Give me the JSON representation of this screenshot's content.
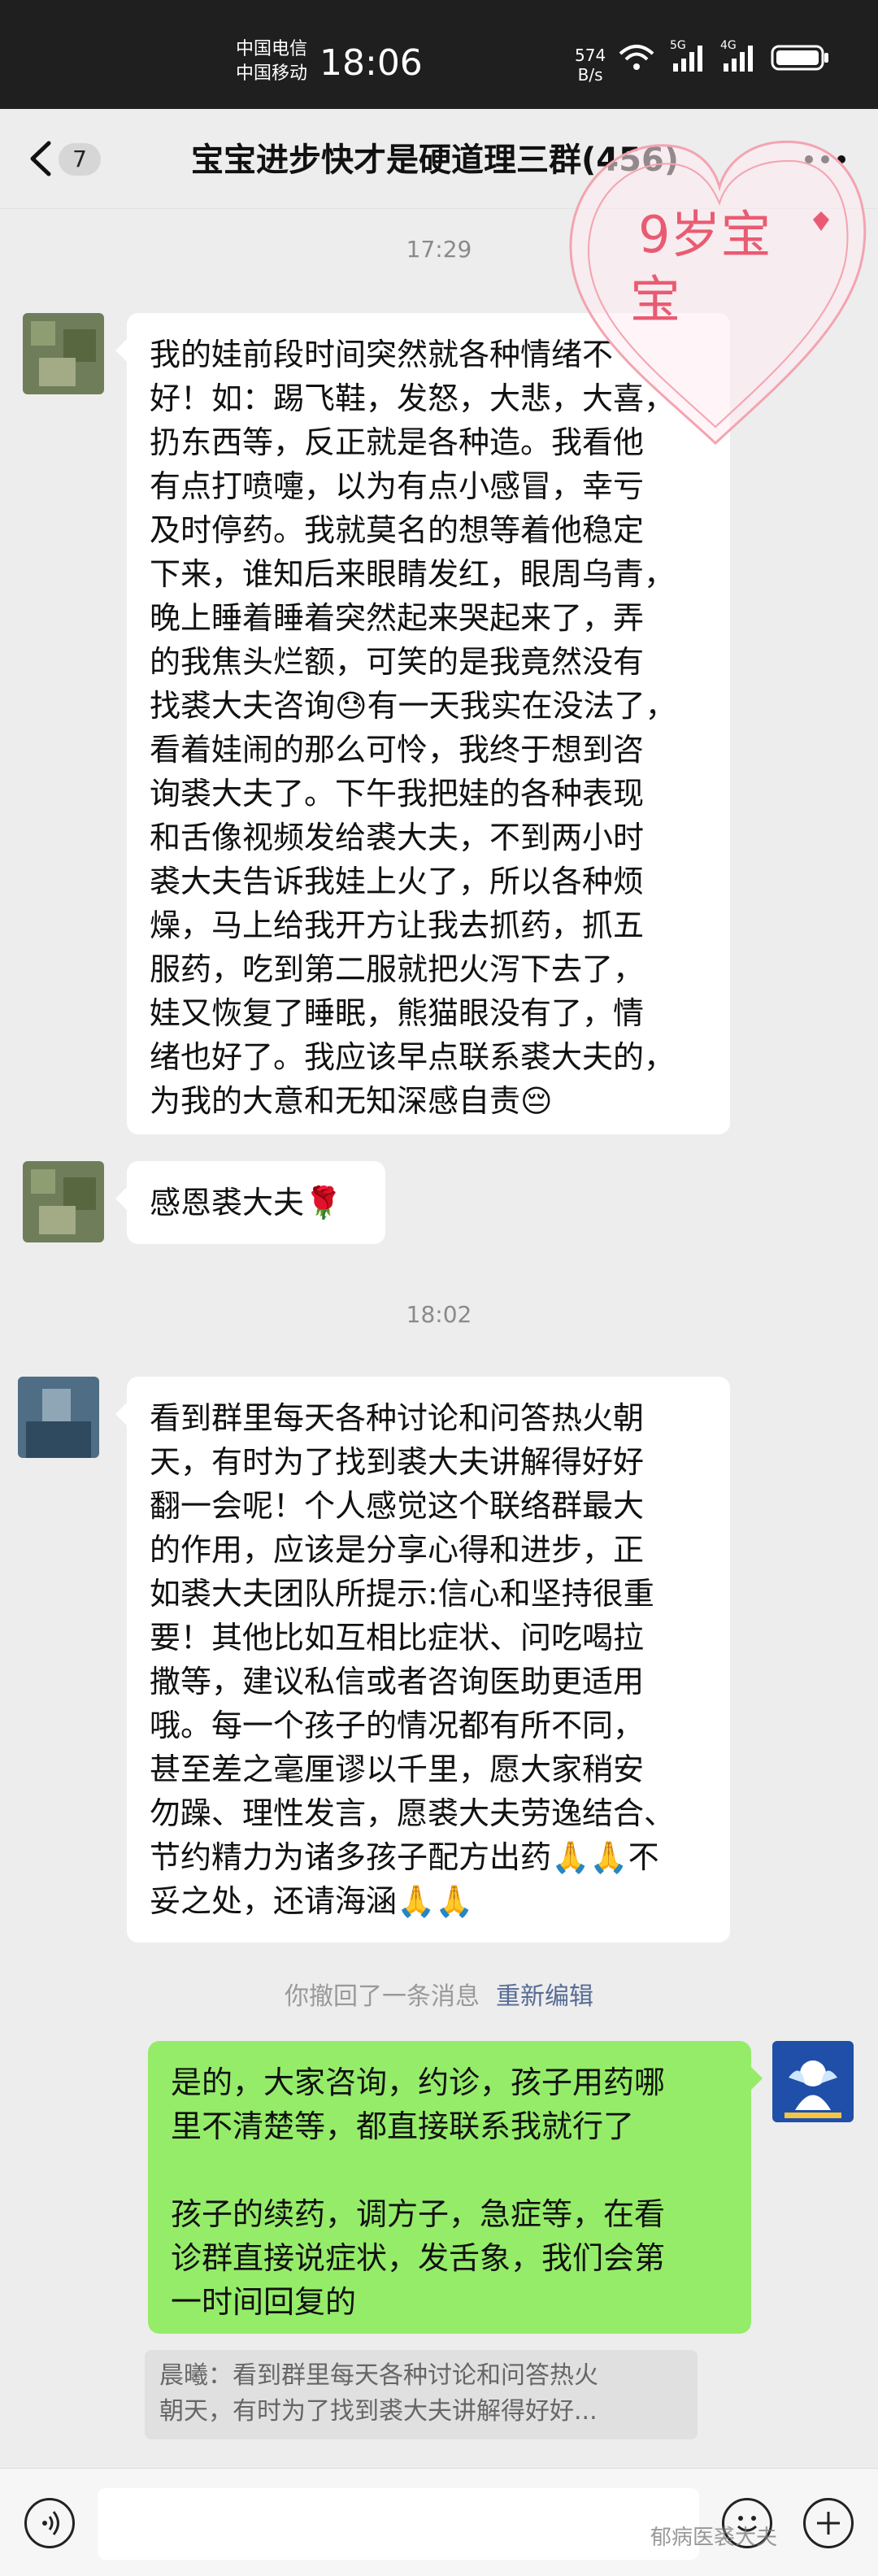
{
  "status_bar": {
    "carrier_1": "中国电信",
    "carrier_2": "中国移动",
    "time": "18:06",
    "net_speed_value": "574",
    "net_speed_unit": "B/s",
    "net_1": "5G",
    "net_2": "4G"
  },
  "nav": {
    "unread_count": "7",
    "title": "宝宝进步快才是硬道理三群(456)",
    "more_icon": "more-dots-icon"
  },
  "sticker": {
    "text_line1": "9岁宝",
    "text_line2": "宝",
    "color": "#e95b72"
  },
  "messages": [
    {
      "type": "time",
      "text": "17:29"
    },
    {
      "type": "msg",
      "side": "left",
      "lines": [
        "我的娃前段时间突然就各种情绪不",
        "好！如：踢飞鞋，发怒，大悲，大喜，",
        "扔东西等，反正就是各种造。我看他",
        "有点打喷嚏，以为有点小感冒，幸亏",
        "及时停药。我就莫名的想等着他稳定",
        "下来，谁知后来眼睛发红，眼周乌青，",
        "晚上睡着睡着突然起来哭起来了，弄",
        "的我焦头烂额，可笑的是我竟然没有",
        "找裘大夫咨询😓有一天我实在没法了，",
        "看着娃闹的那么可怜，我终于想到咨",
        "询裘大夫了。下午我把娃的各种表现",
        "和舌像视频发给裘大夫，不到两小时",
        "裘大夫告诉我娃上火了，所以各种烦",
        "燥，马上给我开方让我去抓药，抓五",
        "服药，吃到第二服就把火泻下去了，",
        "娃又恢复了睡眠，熊猫眼没有了，情",
        "绪也好了。我应该早点联系裘大夫的，",
        "为我的大意和无知深感自责😔"
      ]
    },
    {
      "type": "msg",
      "side": "left",
      "lines": [
        "感恩裘大夫🌹"
      ]
    },
    {
      "type": "time",
      "text": "18:02"
    },
    {
      "type": "msg",
      "side": "left",
      "lines": [
        "看到群里每天各种讨论和问答热火朝",
        "天，有时为了找到裘大夫讲解得好好",
        "翻一会呢！个人感觉这个联络群最大",
        "的作用，应该是分享心得和进步，正",
        "如裘大夫团队所提示:信心和坚持很重",
        "要！其他比如互相比症状、问吃喝拉",
        "撒等，建议私信或者咨询医助更适用",
        "哦。每一个孩子的情况都有所不同，",
        "甚至差之毫厘谬以千里，愿大家稍安",
        "勿躁、理性发言，愿裘大夫劳逸结合、",
        "节约精力为诸多孩子配方出药🙏🙏不",
        "妥之处，还请海涵🙏🙏"
      ]
    },
    {
      "type": "recall",
      "text": "你撤回了一条消息",
      "action": "重新编辑"
    },
    {
      "type": "msg",
      "side": "right",
      "lines": [
        "是的，大家咨询，约诊，孩子用药哪",
        "里不清楚等，都直接联系我就行了",
        "",
        "孩子的续药，调方子，急症等，在看",
        "诊群直接说症状，发舌象，我们会第",
        "一时间回复的"
      ]
    }
  ],
  "quote": {
    "line1": "晨曦：看到群里每天各种讨论和问答热火",
    "line2": "朝天，有时为了找到裘大夫讲解得好好..."
  },
  "watermark": "郁病医裘大夫",
  "colors": {
    "self_bubble": "#95ec69",
    "other_bubble": "#ffffff",
    "background": "#ededed",
    "link": "#576b95"
  }
}
